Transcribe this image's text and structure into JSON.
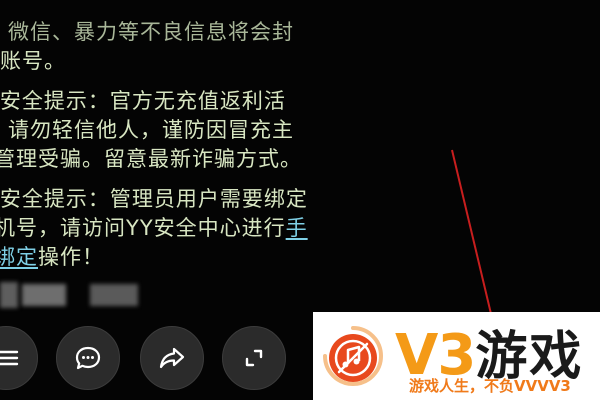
{
  "messages": {
    "line1": "、微信、暴力等不良信息将会封",
    "line2": "账号。",
    "line3": "Y安全提示：官方无充值返利活",
    "line4": "，请勿轻信他人，谨防因冒充主",
    "line5": "管理受骗。留意最新诈骗方式。",
    "line6": "Y安全提示：管理员用户需要绑定",
    "line7": "机号，请访问YY安全中心进行",
    "line7_link": "手",
    "line8_link": "绑定",
    "line8_rest": "操作！"
  },
  "toolbar": {
    "buttons": [
      {
        "name": "menu-icon"
      },
      {
        "name": "chat-bubble-icon"
      },
      {
        "name": "share-arrow-icon"
      },
      {
        "name": "collapse-icon"
      }
    ]
  },
  "watermark": {
    "brand_letters": "V3",
    "brand_cn": "游戏",
    "slogan": "游戏人生，不负VVVV3"
  },
  "colors": {
    "background": "#050505",
    "text": "#d8e6c2",
    "link": "#7fd0e6",
    "brand_orange": "#f49a17",
    "red_annotation": "#c81e1e"
  }
}
